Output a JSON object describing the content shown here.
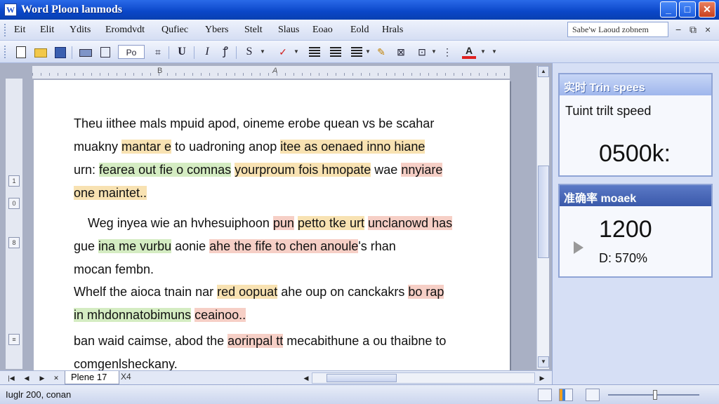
{
  "window": {
    "title": "Word Ploon lanmods",
    "app_icon": "W",
    "min_label": "_",
    "max_label": "□",
    "close_label": "✕"
  },
  "menu": {
    "items": [
      "Eit",
      "Elit",
      "Ydits",
      "Eromdvdt",
      "Qufiec",
      "Ybers",
      "Stelt",
      "Slaus",
      "Eoao",
      "Eold",
      "Hrals"
    ],
    "help_placeholder": "Sabe'w Laoud zobnem",
    "mdi_min": "−",
    "mdi_restore": "⧉",
    "mdi_close": "×"
  },
  "toolbar": {
    "style_box": "Po",
    "text_buttons": [
      "U",
      "I",
      "ꝭ",
      "S"
    ],
    "font_color_label": "A"
  },
  "ruler": {
    "mark_b": "B",
    "mark_a": "A"
  },
  "vruler": {
    "marks": [
      "1",
      "0",
      "8",
      "≡"
    ]
  },
  "document": {
    "paragraphs": [
      [
        [
          {
            "t": "Theu iithee mals mpuid apod, oineme erobe quean vs be scahar",
            "h": ""
          }
        ],
        [
          {
            "t": "muakny ",
            "h": ""
          },
          {
            "t": "mantar e",
            "h": "y"
          },
          {
            "t": " to uadroning anop ",
            "h": ""
          },
          {
            "t": "itee as oenaed inno hiane",
            "h": "y"
          }
        ],
        [
          {
            "t": "urn: ",
            "h": ""
          },
          {
            "t": "fearea out fie o comnas",
            "h": "g"
          },
          {
            "t": " ",
            "h": ""
          },
          {
            "t": "yourproum fois hmopate",
            "h": "y"
          },
          {
            "t": " wae ",
            "h": ""
          },
          {
            "t": "nnyiare",
            "h": "r"
          }
        ],
        [
          {
            "t": "one maintet..",
            "h": "y"
          }
        ]
      ],
      [
        [
          {
            "t": "    Weg inyea wie an hvhesuiphoon ",
            "h": ""
          },
          {
            "t": "pun",
            "h": "r"
          },
          {
            "t": " ",
            "h": ""
          },
          {
            "t": "petto tke urt",
            "h": "y"
          },
          {
            "t": " ",
            "h": ""
          },
          {
            "t": "unclanowd has",
            "h": "r"
          }
        ],
        [
          {
            "t": "gue ",
            "h": ""
          },
          {
            "t": "ina me vurbu",
            "h": "g"
          },
          {
            "t": " aonie ",
            "h": ""
          },
          {
            "t": "ahe the fife to chen anoule",
            "h": "r"
          },
          {
            "t": "'s rhan",
            "h": ""
          }
        ],
        [
          {
            "t": "mocan fembn.",
            "h": ""
          }
        ]
      ],
      [
        [
          {
            "t": "Whelf the aioca tnain nar ",
            "h": ""
          },
          {
            "t": "red oopuat",
            "h": "y"
          },
          {
            "t": " ahe oup on canckakrs ",
            "h": ""
          },
          {
            "t": "bo rap",
            "h": "r"
          }
        ],
        [
          {
            "t": "in mhdonnatobimuns",
            "h": "g"
          },
          {
            "t": " ",
            "h": ""
          },
          {
            "t": "ceainoo..",
            "h": "r"
          }
        ]
      ],
      [
        [
          {
            "t": "ban waid caimse, abod the ",
            "h": ""
          },
          {
            "t": "aorinpal tt",
            "h": "r"
          },
          {
            "t": " mecabithune a ou thaibne to",
            "h": ""
          }
        ],
        [
          {
            "t": "comgenlsheckany.",
            "h": ""
          }
        ]
      ]
    ]
  },
  "tabs": {
    "active": "Plene 17",
    "other": "X4"
  },
  "status": {
    "text": "Iuglr 200, conan"
  },
  "panel": {
    "speed_card": {
      "title": "实时 Trin spees",
      "label": "Tuint trilt speed",
      "value": "0500k:"
    },
    "accuracy_card": {
      "title": "准确率 moaek",
      "value": "1200",
      "sub": "D: 570%"
    }
  },
  "colors": {
    "title_bar": "#0a46c8",
    "highlight_yellow": "#f8e2b2",
    "highlight_green": "#d4ecc2",
    "highlight_red": "#f6cfc6"
  }
}
